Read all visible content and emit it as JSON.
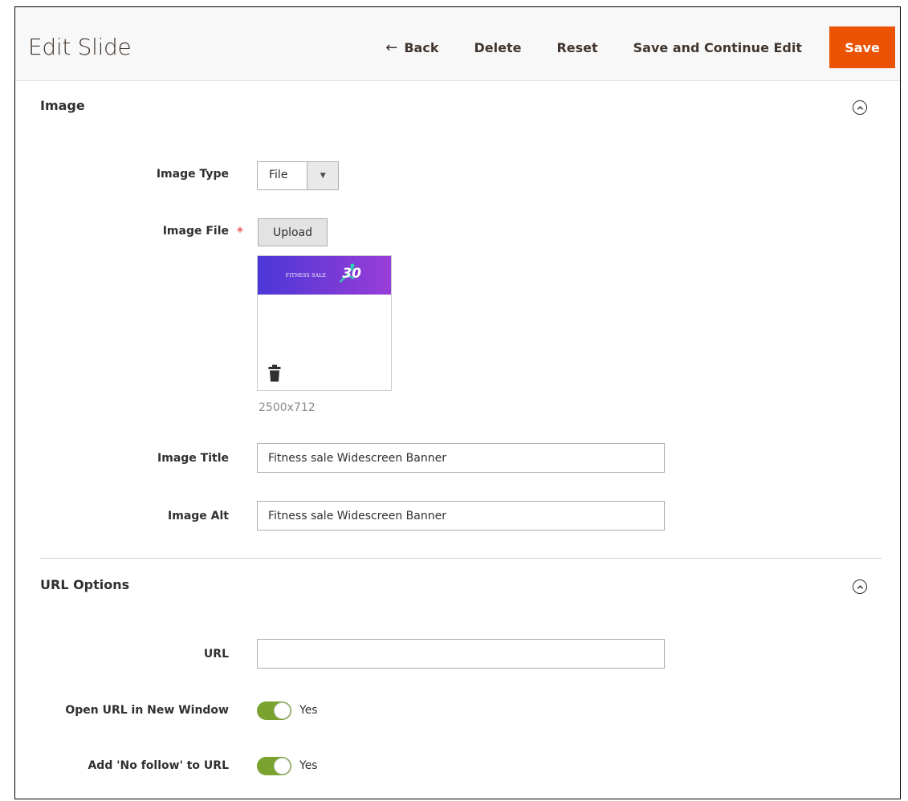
{
  "header": {
    "title": "Edit Slide",
    "back_label": "Back",
    "delete_label": "Delete",
    "reset_label": "Reset",
    "save_continue_label": "Save and Continue Edit",
    "save_label": "Save"
  },
  "image_section": {
    "title": "Image",
    "image_type": {
      "label": "Image Type",
      "value": "File"
    },
    "image_file": {
      "label": "Image File",
      "required_mark": "*",
      "upload_label": "Upload",
      "dimensions": "2500x712"
    },
    "preview_banner": {
      "text": "FITNESS SALE",
      "number": "30"
    },
    "image_title": {
      "label": "Image Title",
      "value": "Fitness sale Widescreen Banner"
    },
    "image_alt": {
      "label": "Image Alt",
      "value": "Fitness sale Widescreen Banner"
    }
  },
  "url_section": {
    "title": "URL Options",
    "url": {
      "label": "URL",
      "value": ""
    },
    "open_new_window": {
      "label": "Open URL in New Window",
      "state": "Yes"
    },
    "no_follow": {
      "label": "Add 'No follow' to URL",
      "state": "Yes"
    }
  },
  "colors": {
    "primary_action": "#eb5202",
    "toggle_on": "#79a22e",
    "required": "#e22626"
  }
}
